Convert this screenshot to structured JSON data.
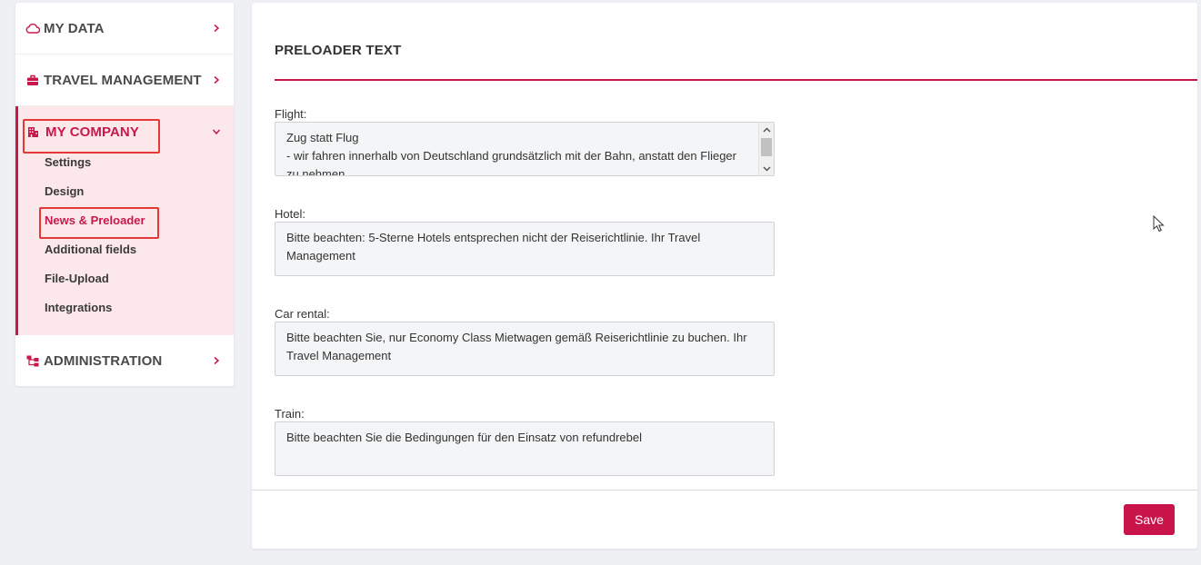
{
  "sidebar": {
    "sections": [
      {
        "label": "MY DATA",
        "icon": "cloud-icon",
        "chevron": "chevron-right-icon"
      },
      {
        "label": "TRAVEL MANAGEMENT",
        "icon": "briefcase-icon",
        "chevron": "chevron-right-icon"
      },
      {
        "label": "MY COMPANY",
        "icon": "building-icon",
        "chevron": "chevron-down-icon",
        "expanded": true
      },
      {
        "label": "ADMINISTRATION",
        "icon": "sitemap-icon",
        "chevron": "chevron-right-icon"
      }
    ],
    "company_items": [
      {
        "label": "Settings"
      },
      {
        "label": "Design"
      },
      {
        "label": "News & Preloader",
        "active": true
      },
      {
        "label": "Additional fields"
      },
      {
        "label": "File-Upload"
      },
      {
        "label": "Integrations"
      }
    ]
  },
  "main": {
    "title": "PRELOADER TEXT",
    "fields": [
      {
        "label": "Flight:",
        "lines": [
          "Zug statt Flug",
          "- wir fahren innerhalb von Deutschland grundsätzlich mit der Bahn, anstatt den Flieger",
          "zu nehmen"
        ]
      },
      {
        "label": "Hotel:",
        "lines": [
          "Bitte beachten: 5-Sterne Hotels entsprechen nicht der Reiserichtlinie. Ihr Travel",
          "Management"
        ]
      },
      {
        "label": "Car rental:",
        "lines": [
          "Bitte beachten Sie, nur Economy Class Mietwagen gemäß Reiserichtlinie zu buchen. Ihr",
          "Travel Management"
        ]
      },
      {
        "label": "Train:",
        "lines": [
          "Bitte beachten Sie die Bedingungen für den Einsatz von refundrebel"
        ]
      }
    ],
    "save_label": "Save"
  },
  "colors": {
    "accent": "#c8184a",
    "highlight_box": "#e53935",
    "active_bg": "#fce8ea"
  }
}
